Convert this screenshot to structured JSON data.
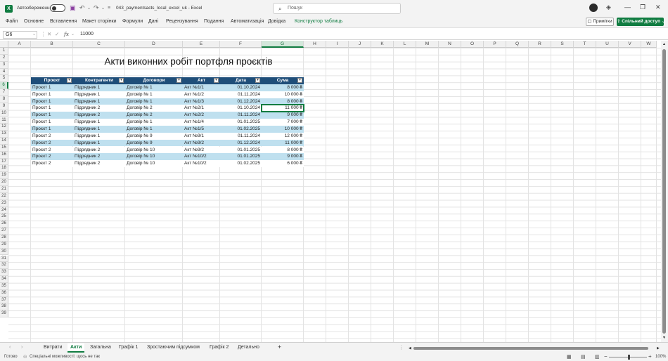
{
  "window": {
    "autosave_label": "Автозбереження",
    "doc_title": "043_paymentsacts_local_excel_uk  -  Excel",
    "search_placeholder": "Пошук"
  },
  "menu": {
    "items": [
      "Файл",
      "Основне",
      "Вставлення",
      "Макет сторінки",
      "Формули",
      "Дані",
      "Рецензування",
      "Подання",
      "Автоматизація",
      "Довідка",
      "Конструктор таблиць"
    ],
    "comments_label": "Примітки",
    "share_label": "Спільний доступ"
  },
  "formula_bar": {
    "name_box": "G6",
    "formula": "11000"
  },
  "columns": [
    "A",
    "B",
    "C",
    "D",
    "E",
    "F",
    "G",
    "H",
    "I",
    "J",
    "K",
    "L",
    "M",
    "N",
    "O",
    "P",
    "Q",
    "R",
    "S",
    "T",
    "U",
    "V",
    "W"
  ],
  "rows": [
    "1",
    "2",
    "3",
    "4",
    "5",
    "6",
    "7",
    "8",
    "9",
    "10",
    "11",
    "12",
    "13",
    "14",
    "15",
    "16",
    "17",
    "18",
    "19",
    "20",
    "21",
    "22",
    "23",
    "24",
    "25",
    "26",
    "27",
    "28",
    "29",
    "30",
    "31",
    "32",
    "33",
    "34",
    "35",
    "36",
    "37",
    "38",
    "39"
  ],
  "sheet": {
    "title": "Акти виконних робіт портфля проєктів",
    "headers": [
      "Проєкт",
      "Контрагенти",
      "Договори",
      "Акт",
      "Дата",
      "Сума"
    ],
    "rows": [
      [
        "Проєкт 1",
        "Підрядник 1",
        "Договір № 1",
        "Акт №1/1",
        "01.10.2024",
        "8 000 ₴"
      ],
      [
        "Проєкт 1",
        "Підрядник 1",
        "Договір № 1",
        "Акт №1/2",
        "01.11.2024",
        "10 000 ₴"
      ],
      [
        "Проєкт 1",
        "Підрядник 1",
        "Договір № 1",
        "Акт №1/3",
        "01.12.2024",
        "8 000 ₴"
      ],
      [
        "Проєкт 1",
        "Підрядник 2",
        "Договір № 2",
        "Акт №2/1",
        "01.10.2024",
        "11 000 ₴"
      ],
      [
        "Проєкт 1",
        "Підрядник 2",
        "Договір № 2",
        "Акт №2/2",
        "01.11.2024",
        "9 000 ₴"
      ],
      [
        "Проєкт 1",
        "Підрядник 1",
        "Договір № 1",
        "Акт №1/4",
        "01.01.2025",
        "7 000 ₴"
      ],
      [
        "Проєкт 1",
        "Підрядник 1",
        "Договір № 1",
        "Акт №1/5",
        "01.02.2025",
        "10 000 ₴"
      ],
      [
        "Проєкт 2",
        "Підрядник 1",
        "Договір № 9",
        "Акт №9/1",
        "01.11.2024",
        "12 000 ₴"
      ],
      [
        "Проєкт 2",
        "Підрядник 1",
        "Договір № 9",
        "Акт №9/2",
        "01.12.2024",
        "11 000 ₴"
      ],
      [
        "Проєкт 2",
        "Підрядник 2",
        "Договір № 10",
        "Акт №9/2",
        "01.01.2025",
        "8 000 ₴"
      ],
      [
        "Проєкт 2",
        "Підрядник 2",
        "Договір № 10",
        "Акт №10/2",
        "01.01.2025",
        "9 000 ₴"
      ],
      [
        "Проєкт 2",
        "Підрядник 2",
        "Договір № 10",
        "Акт №10/2",
        "01.02.2025",
        "6 000 ₴"
      ]
    ]
  },
  "sheet_tabs": [
    "Витрати",
    "Акти",
    "Загальна",
    "Графік 1",
    "Зростаючим підсумком",
    "Графік 2",
    "Детально"
  ],
  "active_tab": "Акти",
  "status": {
    "ready": "Готово",
    "accessibility": "Спеціальні можливості: щось не так",
    "zoom": "100%"
  },
  "colors": {
    "accent": "#107c41",
    "table_header": "#1f4e79",
    "band": "#bfe0ef"
  }
}
